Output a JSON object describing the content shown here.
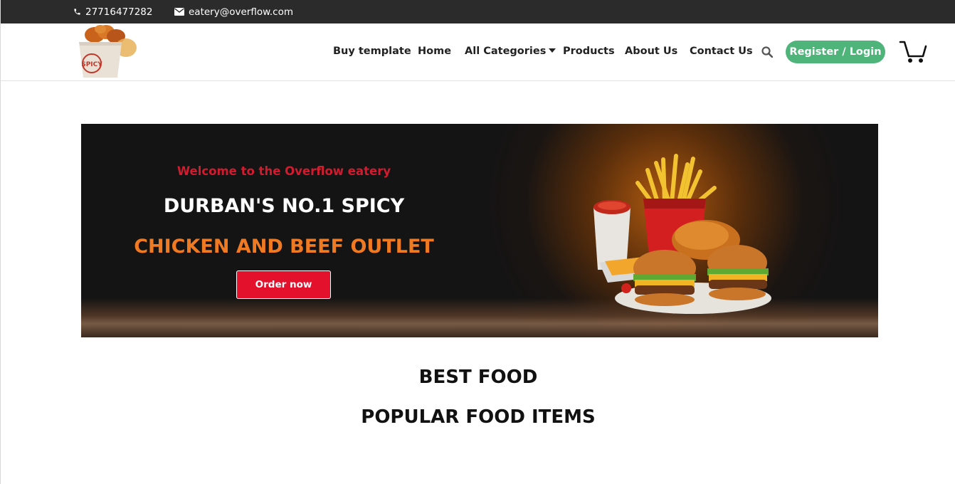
{
  "topbar": {
    "phone": "27716477282",
    "email": "eatery@overflow.com",
    "icons": {
      "phone": "phone-icon",
      "email": "envelope-icon"
    }
  },
  "header": {
    "logo": {
      "icon": "spicy-chicken-bucket-logo",
      "text": "SPICY"
    },
    "nav": {
      "buy_template": "Buy template",
      "home": "Home",
      "all_categories": "All Categories",
      "products": "Products",
      "about": "About Us",
      "contact": "Contact Us"
    },
    "register_label": "Register / Login",
    "icons": {
      "search": "search-icon",
      "cart": "cart-icon",
      "caret": "caret-down-icon"
    }
  },
  "hero": {
    "welcome": "Welcome to the Overflow eatery",
    "line1": "DURBAN'S NO.1 SPICY",
    "line2": "CHICKEN AND BEEF OUTLET",
    "order_label": "Order now"
  },
  "sections": {
    "best_food": "BEST FOOD",
    "popular": "POPULAR FOOD ITEMS"
  },
  "colors": {
    "topbar_bg": "#2b2b2b",
    "register_green": "#4fb47a",
    "welcome_red": "#d11b2f",
    "headline_orange": "#f07a22",
    "order_red": "#e3112b"
  }
}
